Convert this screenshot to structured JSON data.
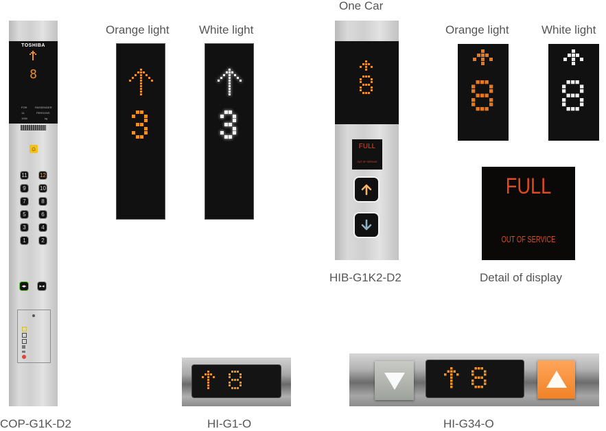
{
  "captions": {
    "cop": "COP-G1K-D2",
    "orange_light_1": "Orange light",
    "white_light_1": "White light",
    "one_car": "One Car",
    "hib": "HIB-G1K2-D2",
    "orange_light_2": "Orange light",
    "white_light_2": "White light",
    "detail": "Detail of display",
    "hi_g1": "HI-G1-O",
    "hi_g34": "HI-G34-O"
  },
  "cop_panel": {
    "brand": "TOSHIBA",
    "direction": "up",
    "floor": "8",
    "capacity_lines": [
      {
        "left": "FOR",
        "right": "PASSENGER"
      },
      {
        "left": "14",
        "right": "PERSONS"
      },
      {
        "left": "1050",
        "right": "kg"
      }
    ],
    "alarm_icon": "bell-icon",
    "floor_buttons": [
      {
        "label": "11",
        "lit": false
      },
      {
        "label": "12",
        "lit": true
      },
      {
        "label": "9",
        "lit": false
      },
      {
        "label": "10",
        "lit": false
      },
      {
        "label": "7",
        "lit": false
      },
      {
        "label": "8",
        "lit": false
      },
      {
        "label": "5",
        "lit": false
      },
      {
        "label": "6",
        "lit": false
      },
      {
        "label": "3",
        "lit": false
      },
      {
        "label": "4",
        "lit": false
      },
      {
        "label": "1",
        "lit": false
      },
      {
        "label": "2",
        "lit": false
      }
    ],
    "open_label": "OPEN",
    "close_label": "CLOSE"
  },
  "display_samples": {
    "tall_orange": {
      "direction": "up",
      "floor": "3",
      "color": "#f0901e"
    },
    "tall_white": {
      "direction": "up",
      "floor": "3",
      "color": "#f4f4f4"
    },
    "small_orange": {
      "direction": "up",
      "floor": "8",
      "color": "#e8781e"
    },
    "small_white": {
      "direction": "up",
      "floor": "8",
      "color": "#eeeeee"
    }
  },
  "hib_panel": {
    "direction": "up",
    "floor": "8",
    "status_main": "FULL",
    "status_sub": "OUT OF SERVICE",
    "up_icon": "arrow-up-icon",
    "down_icon": "arrow-down-icon"
  },
  "detail_display": {
    "main": "FULL",
    "sub": "OUT OF SERVICE",
    "color": "#e04a1e"
  },
  "hi_g1": {
    "direction": "up",
    "floor": "8"
  },
  "hi_g34": {
    "direction": "up",
    "floor": "8",
    "down_icon": "triangle-down-icon",
    "up_icon": "triangle-up-icon"
  },
  "colors": {
    "orange": "#f0901e",
    "white": "#f2f2f2",
    "display_bg": "#111111",
    "status_red": "#e04a1e"
  }
}
